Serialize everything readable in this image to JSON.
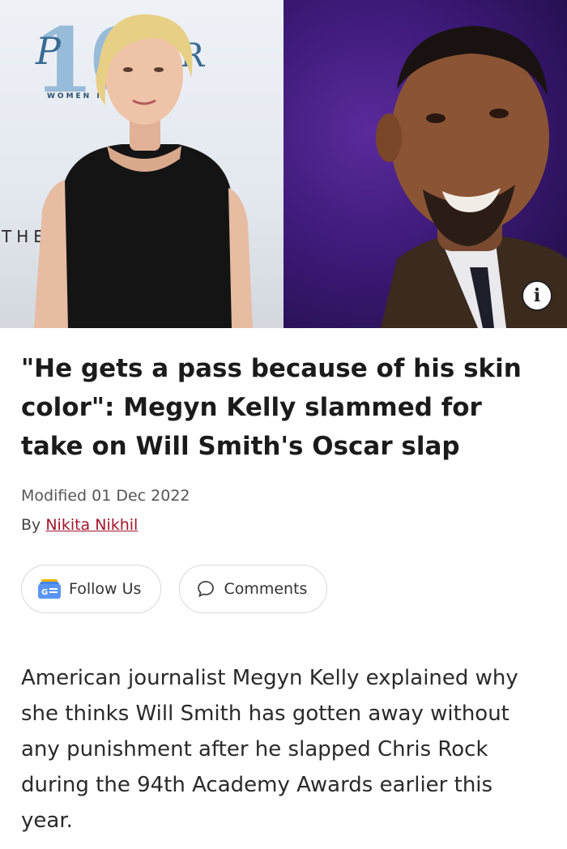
{
  "hero": {
    "left_backdrop": {
      "number": "10",
      "letter_p": "P",
      "letter_r": "R",
      "women_text": "WOMEN I",
      "the_text": "THE"
    },
    "info_icon": "info-icon"
  },
  "article": {
    "headline": "\"He gets a pass because of his skin color\": Megyn Kelly slammed for take on Will Smith's Oscar slap",
    "modified": "Modified 01 Dec 2022",
    "by_prefix": "By ",
    "author": "Nikita Nikhil",
    "follow_label": "Follow Us",
    "comments_label": "Comments",
    "body": "American journalist Megyn Kelly explained why she thinks Will Smith has gotten away without any punishment after he slapped Chris Rock during the 94th Academy Awards earlier this year."
  },
  "colors": {
    "author_link": "#a3152a",
    "right_photo_bg": "#3d1a78"
  }
}
